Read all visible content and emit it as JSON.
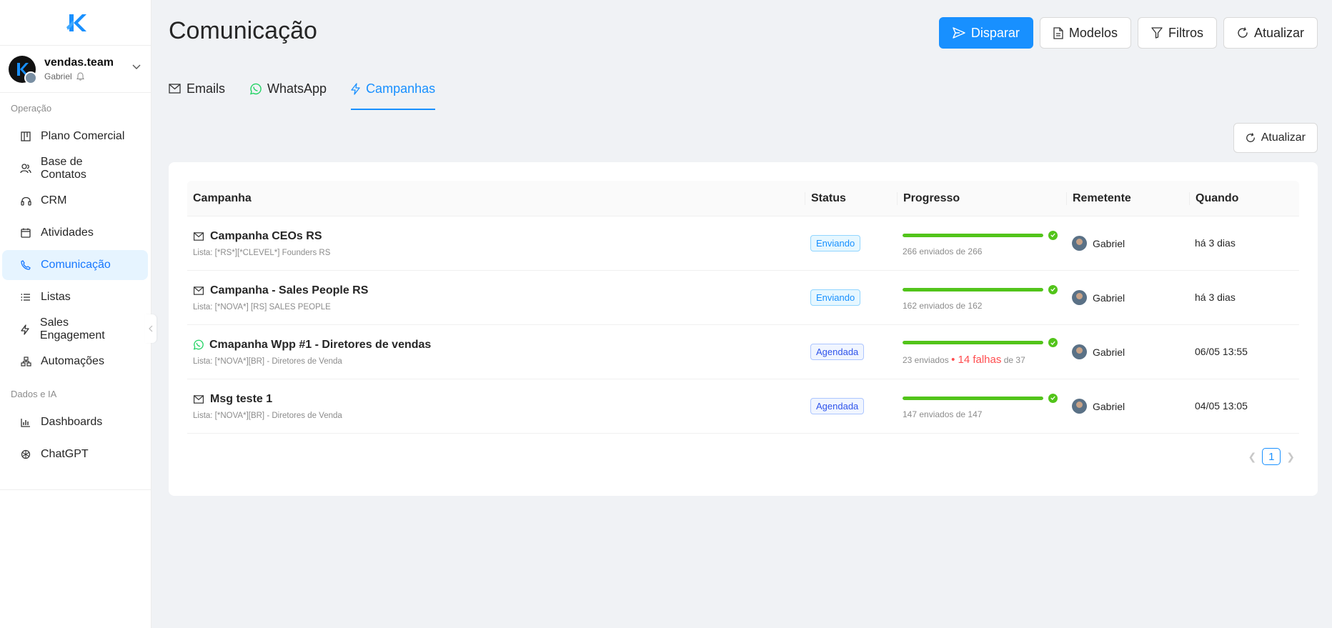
{
  "sidebar": {
    "logo_letter": "K",
    "account": {
      "name": "vendas.team",
      "user": "Gabriel"
    },
    "sections": [
      {
        "label": "Operação",
        "items": [
          {
            "label": "Plano Comercial",
            "icon": "board-icon"
          },
          {
            "label": "Base de Contatos",
            "icon": "contacts-icon"
          },
          {
            "label": "CRM",
            "icon": "headset-icon"
          },
          {
            "label": "Atividades",
            "icon": "calendar-icon"
          },
          {
            "label": "Comunicação",
            "icon": "phone-icon",
            "active": true
          },
          {
            "label": "Listas",
            "icon": "list-icon"
          },
          {
            "label": "Sales Engagement",
            "icon": "bolt-icon"
          },
          {
            "label": "Automações",
            "icon": "hierarchy-icon"
          }
        ]
      },
      {
        "label": "Dados e IA",
        "items": [
          {
            "label": "Dashboards",
            "icon": "bar-chart-icon"
          },
          {
            "label": "ChatGPT",
            "icon": "openai-icon"
          }
        ]
      }
    ]
  },
  "header": {
    "title": "Comunicação",
    "actions": {
      "disparar": "Disparar",
      "modelos": "Modelos",
      "filtros": "Filtros",
      "atualizar": "Atualizar"
    }
  },
  "tabs": [
    {
      "label": "Emails",
      "icon": "mail-icon"
    },
    {
      "label": "WhatsApp",
      "icon": "whatsapp-icon"
    },
    {
      "label": "Campanhas",
      "icon": "bolt-icon",
      "active": true
    }
  ],
  "refresh_label": "Atualizar",
  "table": {
    "columns": {
      "campanha": "Campanha",
      "status": "Status",
      "progresso": "Progresso",
      "remetente": "Remetente",
      "quando": "Quando"
    },
    "rows": [
      {
        "type": "email",
        "name": "Campanha CEOs RS",
        "list": "Lista: [*RS*][*CLEVEL*] Founders RS",
        "status": "Enviando",
        "status_kind": "sending",
        "progress": 1.0,
        "progress_text": "266 enviados de 266",
        "sender": "Gabriel",
        "when": "há 3 dias"
      },
      {
        "type": "email",
        "name": "Campanha - Sales People RS",
        "list": "Lista: [*NOVA*] [RS] SALES PEOPLE",
        "status": "Enviando",
        "status_kind": "sending",
        "progress": 1.0,
        "progress_text": "162 enviados de 162",
        "sender": "Gabriel",
        "when": "há 3 dias"
      },
      {
        "type": "whatsapp",
        "name": "Cmapanha Wpp #1 - Diretores de vendas",
        "list": "Lista: [*NOVA*][BR] - Diretores de Venda",
        "status": "Agendada",
        "status_kind": "scheduled",
        "progress": 1.0,
        "progress_sent": "23 enviados",
        "progress_fail": "14 falhas",
        "progress_total": "de 37",
        "sender": "Gabriel",
        "when": "06/05 13:55"
      },
      {
        "type": "email",
        "name": "Msg teste 1",
        "list": "Lista: [*NOVA*][BR] - Diretores de Venda",
        "status": "Agendada",
        "status_kind": "scheduled",
        "progress": 1.0,
        "progress_text": "147 enviados de 147",
        "sender": "Gabriel",
        "when": "04/05 13:05"
      }
    ]
  },
  "pagination": {
    "current": "1"
  },
  "colors": {
    "accent": "#1890ff",
    "progress": "#52c41a",
    "fail": "#ff4d4f"
  }
}
